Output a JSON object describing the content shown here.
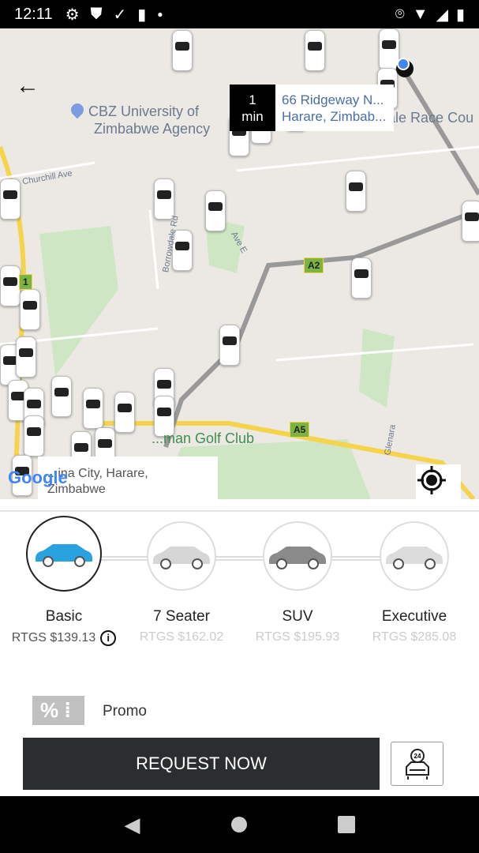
{
  "status_bar": {
    "time": "12:11",
    "icons": [
      "gear-icon",
      "shield-icon",
      "download-done-icon",
      "sd-card-icon",
      "dot-icon",
      "location-icon",
      "wifi-icon",
      "signal-icon",
      "battery-icon"
    ]
  },
  "map": {
    "eta": {
      "value": "1",
      "unit": "min"
    },
    "destination": {
      "line1": "66 Ridgeway N...",
      "line2": "Harare, Zimbab..."
    },
    "pois": [
      "CBZ University of",
      "Zimbabwe Agency",
      "Borrowdale Race Cou",
      "...man Golf Club"
    ],
    "streets": [
      "Churchill Ave",
      "Borrowdale Rd",
      "Glenara",
      "Ave E"
    ],
    "road_badges": [
      "A2",
      "A5",
      "1"
    ],
    "pickup": {
      "line1": "...ina City, Harare,",
      "line2": "Zimbabwe"
    },
    "attribution": "Google"
  },
  "vehicles": [
    {
      "name": "Basic",
      "price": "RTGS $139.13",
      "selected": true,
      "color": "#29a3e0"
    },
    {
      "name": "7 Seater",
      "price": "RTGS $162.02",
      "selected": false,
      "color": "#d6d6d6"
    },
    {
      "name": "SUV",
      "price": "RTGS $195.93",
      "selected": false,
      "color": "#8a8a8a"
    },
    {
      "name": "Executive",
      "price": "RTGS $285.08",
      "selected": false,
      "color": "#dcdcdc"
    }
  ],
  "promo": {
    "icon": "%",
    "label": "Promo"
  },
  "request_button": "REQUEST NOW"
}
